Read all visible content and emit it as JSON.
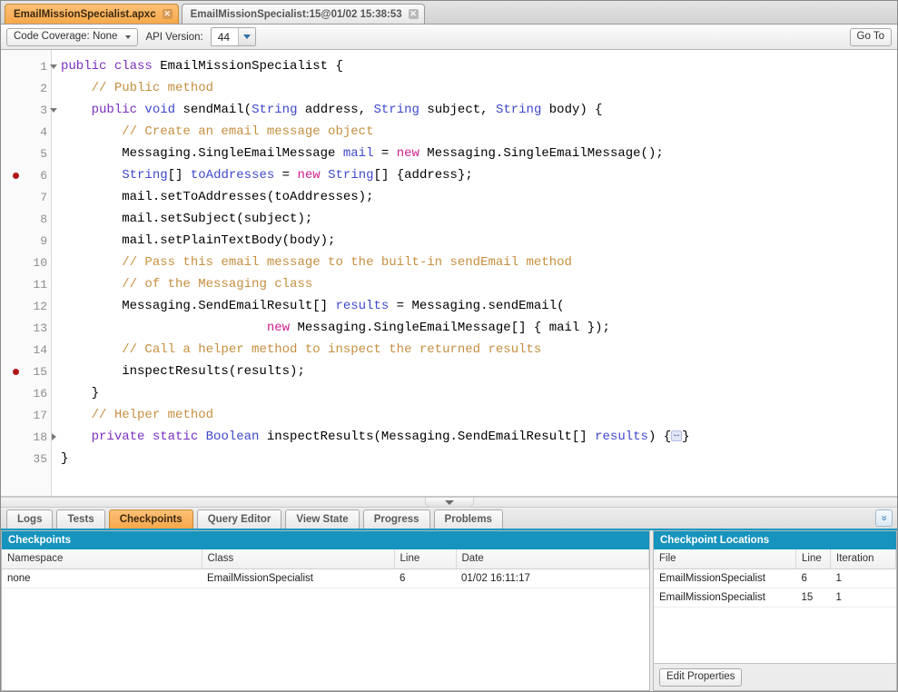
{
  "file_tabs": [
    {
      "label": "EmailMissionSpecialist.apxc",
      "active": true,
      "close": "✕"
    },
    {
      "label": "EmailMissionSpecialist:15@01/02 15:38:53",
      "active": false,
      "close": "✕"
    }
  ],
  "toolbar": {
    "code_coverage_label": "Code Coverage: None",
    "api_version_label": "API Version:",
    "api_version_value": "44",
    "go_to_label": "Go To"
  },
  "editor": {
    "lines": [
      {
        "num": "1",
        "breakpoint": false,
        "fold": "down",
        "tokens": [
          {
            "t": "public ",
            "c": "kw"
          },
          {
            "t": "class ",
            "c": "kw"
          },
          {
            "t": "EmailMissionSpecialist {",
            "c": ""
          }
        ]
      },
      {
        "num": "2",
        "breakpoint": false,
        "fold": "",
        "tokens": [
          {
            "t": "    ",
            "c": ""
          },
          {
            "t": "// Public method",
            "c": "cm"
          }
        ]
      },
      {
        "num": "3",
        "breakpoint": false,
        "fold": "down",
        "tokens": [
          {
            "t": "    ",
            "c": ""
          },
          {
            "t": "public ",
            "c": "kw"
          },
          {
            "t": "void ",
            "c": "ty"
          },
          {
            "t": "sendMail(",
            "c": ""
          },
          {
            "t": "String",
            "c": "ty"
          },
          {
            "t": " address, ",
            "c": ""
          },
          {
            "t": "String",
            "c": "ty"
          },
          {
            "t": " subject, ",
            "c": ""
          },
          {
            "t": "String",
            "c": "ty"
          },
          {
            "t": " body) {",
            "c": ""
          }
        ]
      },
      {
        "num": "4",
        "breakpoint": false,
        "fold": "",
        "tokens": [
          {
            "t": "        ",
            "c": ""
          },
          {
            "t": "// Create an email message object",
            "c": "cm"
          }
        ]
      },
      {
        "num": "5",
        "breakpoint": false,
        "fold": "",
        "tokens": [
          {
            "t": "        Messaging.SingleEmailMessage ",
            "c": ""
          },
          {
            "t": "mail",
            "c": "vr"
          },
          {
            "t": " = ",
            "c": ""
          },
          {
            "t": "new",
            "c": "nw"
          },
          {
            "t": " Messaging.SingleEmailMessage();",
            "c": ""
          }
        ]
      },
      {
        "num": "6",
        "breakpoint": true,
        "fold": "",
        "tokens": [
          {
            "t": "        ",
            "c": ""
          },
          {
            "t": "String",
            "c": "ty"
          },
          {
            "t": "[] ",
            "c": ""
          },
          {
            "t": "toAddresses",
            "c": "vr"
          },
          {
            "t": " = ",
            "c": ""
          },
          {
            "t": "new",
            "c": "nw"
          },
          {
            "t": " ",
            "c": ""
          },
          {
            "t": "String",
            "c": "ty"
          },
          {
            "t": "[] {address};",
            "c": ""
          }
        ]
      },
      {
        "num": "7",
        "breakpoint": false,
        "fold": "",
        "tokens": [
          {
            "t": "        mail.setToAddresses(toAddresses);",
            "c": ""
          }
        ]
      },
      {
        "num": "8",
        "breakpoint": false,
        "fold": "",
        "tokens": [
          {
            "t": "        mail.setSubject(subject);",
            "c": ""
          }
        ]
      },
      {
        "num": "9",
        "breakpoint": false,
        "fold": "",
        "tokens": [
          {
            "t": "        mail.setPlainTextBody(body);",
            "c": ""
          }
        ]
      },
      {
        "num": "10",
        "breakpoint": false,
        "fold": "",
        "tokens": [
          {
            "t": "        ",
            "c": ""
          },
          {
            "t": "// Pass this email message to the built-in sendEmail method",
            "c": "cm"
          }
        ]
      },
      {
        "num": "11",
        "breakpoint": false,
        "fold": "",
        "tokens": [
          {
            "t": "        ",
            "c": ""
          },
          {
            "t": "// of the Messaging class",
            "c": "cm"
          }
        ]
      },
      {
        "num": "12",
        "breakpoint": false,
        "fold": "",
        "tokens": [
          {
            "t": "        Messaging.SendEmailResult[] ",
            "c": ""
          },
          {
            "t": "results",
            "c": "vr"
          },
          {
            "t": " = Messaging.sendEmail(",
            "c": ""
          }
        ]
      },
      {
        "num": "13",
        "breakpoint": false,
        "fold": "",
        "tokens": [
          {
            "t": "                           ",
            "c": ""
          },
          {
            "t": "new",
            "c": "nw"
          },
          {
            "t": " Messaging.SingleEmailMessage[] { mail });",
            "c": ""
          }
        ]
      },
      {
        "num": "14",
        "breakpoint": false,
        "fold": "",
        "tokens": [
          {
            "t": "        ",
            "c": ""
          },
          {
            "t": "// Call a helper method to inspect the returned results",
            "c": "cm"
          }
        ]
      },
      {
        "num": "15",
        "breakpoint": true,
        "fold": "",
        "tokens": [
          {
            "t": "        inspectResults(results);",
            "c": ""
          }
        ]
      },
      {
        "num": "16",
        "breakpoint": false,
        "fold": "",
        "tokens": [
          {
            "t": "    }",
            "c": ""
          }
        ]
      },
      {
        "num": "17",
        "breakpoint": false,
        "fold": "",
        "tokens": [
          {
            "t": "    ",
            "c": ""
          },
          {
            "t": "// Helper method",
            "c": "cm"
          }
        ]
      },
      {
        "num": "18",
        "breakpoint": false,
        "fold": "right",
        "tokens": [
          {
            "t": "    ",
            "c": ""
          },
          {
            "t": "private ",
            "c": "kw"
          },
          {
            "t": "static ",
            "c": "kw"
          },
          {
            "t": "Boolean",
            "c": "ty"
          },
          {
            "t": " inspectResults(Messaging.SendEmailResult[] ",
            "c": ""
          },
          {
            "t": "results",
            "c": "vr"
          },
          {
            "t": ") {",
            "c": ""
          },
          {
            "t": "FOLD",
            "c": "fold"
          },
          {
            "t": "}",
            "c": ""
          }
        ]
      },
      {
        "num": "35",
        "breakpoint": false,
        "fold": "",
        "tokens": [
          {
            "t": "}",
            "c": ""
          }
        ]
      }
    ],
    "fold_placeholder": "↔"
  },
  "splitter": {
    "handle_icon": "collapse-down-icon"
  },
  "bottom_tabs": [
    {
      "label": "Logs",
      "active": false
    },
    {
      "label": "Tests",
      "active": false
    },
    {
      "label": "Checkpoints",
      "active": true
    },
    {
      "label": "Query Editor",
      "active": false
    },
    {
      "label": "View State",
      "active": false
    },
    {
      "label": "Progress",
      "active": false
    },
    {
      "label": "Problems",
      "active": false
    }
  ],
  "collapse_all_icon": "»",
  "checkpoints_panel": {
    "title": "Checkpoints",
    "columns": [
      "Namespace",
      "Class",
      "Line",
      "Date"
    ],
    "rows": [
      [
        "none",
        "EmailMissionSpecialist",
        "6",
        "01/02 16:11:17"
      ]
    ]
  },
  "locations_panel": {
    "title": "Checkpoint Locations",
    "columns": [
      "File",
      "Line",
      "Iteration"
    ],
    "rows": [
      [
        "EmailMissionSpecialist",
        "6",
        "1"
      ],
      [
        "EmailMissionSpecialist",
        "15",
        "1"
      ]
    ],
    "edit_properties_label": "Edit Properties"
  },
  "colors": {
    "accent_orange": "#f7a849",
    "panel_header_blue": "#1694bd",
    "breakpoint_red": "#b01818",
    "keyword_purple": "#7b2fbe",
    "type_blue": "#3f48cc",
    "comment_tan": "#c58f3f",
    "new_magenta": "#d0208e"
  }
}
